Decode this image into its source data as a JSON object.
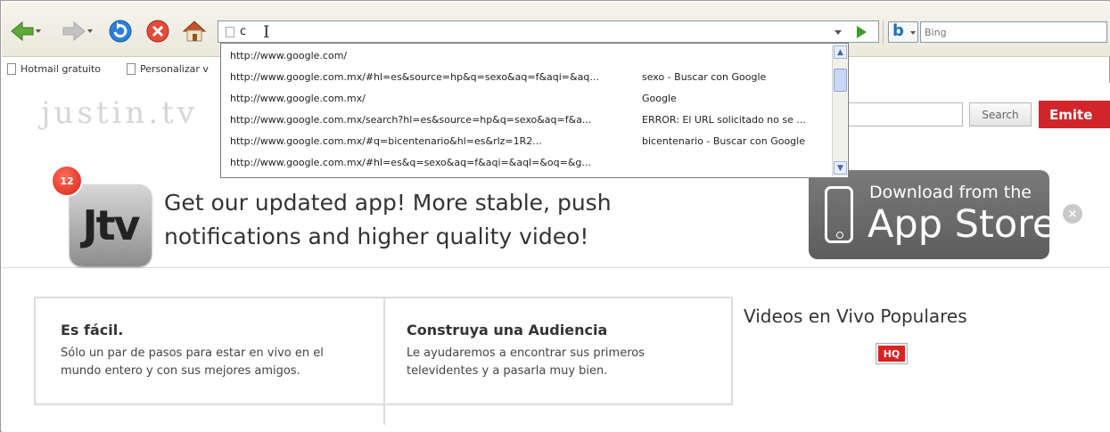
{
  "toolbar": {
    "url_text": "c",
    "search_placeholder": "Bing"
  },
  "bookmarks": [
    {
      "label": "Hotmail gratuito"
    },
    {
      "label": "Personalizar v"
    }
  ],
  "page": {
    "logo": "justin.tv",
    "search_button": "Search",
    "emite_button": "Emite",
    "badge_count": "12",
    "app_icon_label": "Jtv",
    "promo_line1": "Get our updated app! More stable, push",
    "promo_line2": "notifications and higher quality video!",
    "appstore_line1": "Download from the",
    "appstore_line2": "App Store",
    "close_label": "×",
    "feature1_title": "Es fácil.",
    "feature1_desc": "Sólo un par de pasos para estar en vivo en el mundo entero y con sus mejores amigos.",
    "feature2_title": "Construya una Audiencia",
    "feature2_desc": "Le ayudaremos a encontrar sus primeros televidentes y a pasarla muy bien.",
    "popular_title": "Videos en Vivo Populares",
    "hq_label": "HQ"
  },
  "suggestions": [
    {
      "url": "http://www.google.com/",
      "title": ""
    },
    {
      "url": "http://www.google.com.mx/#hl=es&source=hp&q=sexo&aq=f&aqi=&aq...",
      "title": "sexo - Buscar con Google"
    },
    {
      "url": "http://www.google.com.mx/",
      "title": "Google"
    },
    {
      "url": "http://www.google.com.mx/search?hl=es&source=hp&q=sexo&aq=f&a...",
      "title": "ERROR: El URL solicitado no se ..."
    },
    {
      "url": "http://www.google.com.mx/#q=bicentenario&hl=es&rlz=1R2...",
      "title": "bicentenario - Buscar con Google"
    },
    {
      "url": "http://www.google.com.mx/#hl=es&q=sexo&aq=f&aqi=&aql=&oq=&g...",
      "title": ""
    }
  ]
}
